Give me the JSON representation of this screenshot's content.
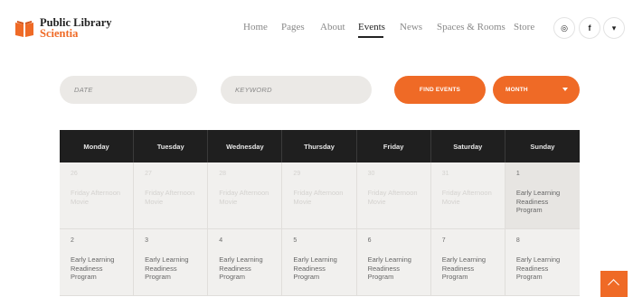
{
  "header": {
    "logo": {
      "line1": "Public Library",
      "line2": "Scientia",
      "icon": "book-icon"
    },
    "nav": [
      {
        "label": "Home",
        "active": false
      },
      {
        "label": "Pages",
        "active": false
      },
      {
        "label": "About",
        "active": false
      },
      {
        "label": "Events",
        "active": true
      },
      {
        "label": "News",
        "active": false
      },
      {
        "label": "Spaces & Rooms",
        "active": false
      },
      {
        "label": "Store",
        "active": false
      }
    ],
    "social": [
      {
        "name": "dribbble-icon",
        "glyph": "◎"
      },
      {
        "name": "facebook-icon",
        "glyph": "f"
      },
      {
        "name": "twitter-icon",
        "glyph": "▾"
      }
    ]
  },
  "search": {
    "date_placeholder": "DATE",
    "keyword_placeholder": "KEYWORD",
    "find_label": "FIND EVENTS",
    "view_label": "MONTH"
  },
  "calendar": {
    "weekdays": [
      "Monday",
      "Tuesday",
      "Wednesday",
      "Thursday",
      "Friday",
      "Saturday",
      "Sunday"
    ],
    "rows": [
      [
        {
          "day": "26",
          "event": "Friday Afternoon Movie",
          "state": "past"
        },
        {
          "day": "27",
          "event": "Friday Afternoon Movie",
          "state": "past"
        },
        {
          "day": "28",
          "event": "Friday Afternoon Movie",
          "state": "past"
        },
        {
          "day": "29",
          "event": "Friday Afternoon Movie",
          "state": "past"
        },
        {
          "day": "30",
          "event": "Friday Afternoon Movie",
          "state": "past"
        },
        {
          "day": "31",
          "event": "Friday Afternoon Movie",
          "state": "past"
        },
        {
          "day": "1",
          "event": "Early Learning Readiness Program",
          "state": "today"
        }
      ],
      [
        {
          "day": "2",
          "event": "Early Learning Readiness Program",
          "state": "current"
        },
        {
          "day": "3",
          "event": "Early Learning Readiness Program",
          "state": "current"
        },
        {
          "day": "4",
          "event": "Early Learning Readiness Program",
          "state": "current"
        },
        {
          "day": "5",
          "event": "Early Learning Readiness Program",
          "state": "current"
        },
        {
          "day": "6",
          "event": "Early Learning Readiness Program",
          "state": "current"
        },
        {
          "day": "7",
          "event": "Early Learning Readiness Program",
          "state": "current"
        },
        {
          "day": "8",
          "event": "Early Learning Readiness Program",
          "state": "current"
        }
      ]
    ]
  },
  "colors": {
    "accent": "#ef6a26",
    "header_bg": "#1f1f1f",
    "field_bg": "#ebe9e6"
  },
  "scroll_top_icon": "chevron-up-icon"
}
